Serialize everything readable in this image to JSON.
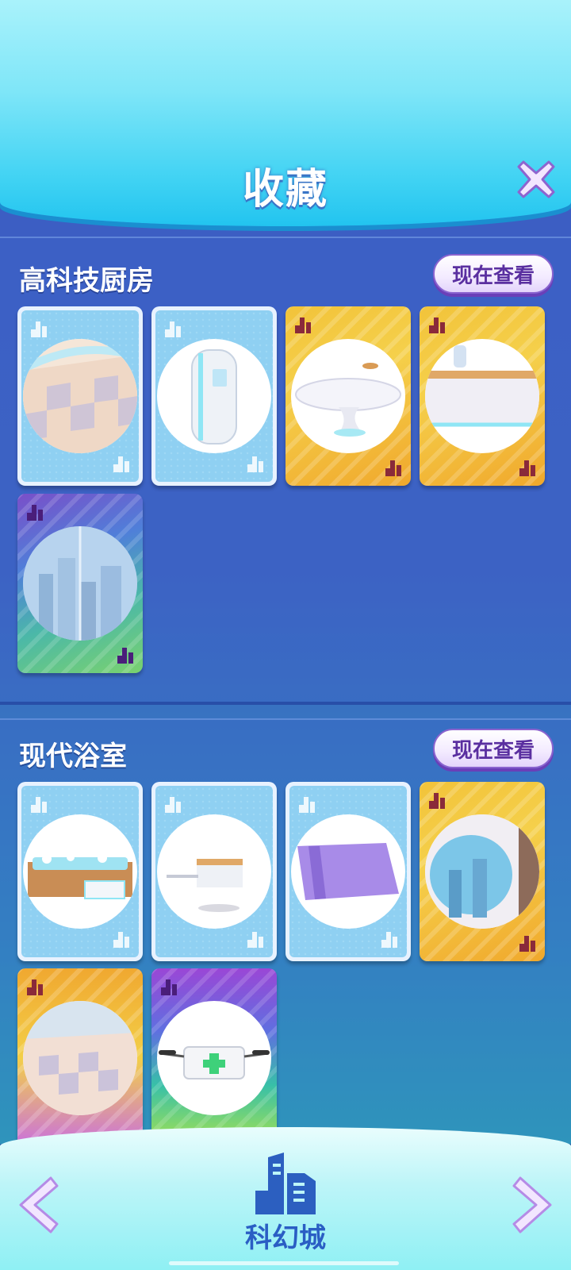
{
  "header": {
    "title": "收藏",
    "close_icon": "close-icon"
  },
  "sections": [
    {
      "title": "高科技厨房",
      "view_label": "现在查看",
      "cards": [
        {
          "frame": "blue",
          "item": "tiled-floor"
        },
        {
          "frame": "blue",
          "item": "fridge-pod"
        },
        {
          "frame": "gold",
          "item": "round-table"
        },
        {
          "frame": "gold",
          "item": "kitchen-counter"
        },
        {
          "frame": "rainbow",
          "item": "city-window"
        }
      ]
    },
    {
      "title": "现代浴室",
      "view_label": "现在查看",
      "cards": [
        {
          "frame": "blue",
          "item": "bathtub"
        },
        {
          "frame": "blue",
          "item": "wall-shelf"
        },
        {
          "frame": "blue",
          "item": "purple-rug"
        },
        {
          "frame": "gold",
          "item": "round-window"
        },
        {
          "frame": "goldpurple",
          "item": "bathroom-floor"
        },
        {
          "frame": "rainbow2",
          "item": "medical-drone"
        }
      ]
    }
  ],
  "footer": {
    "collection_name": "科幻城",
    "prev_icon": "chevron-left-icon",
    "next_icon": "chevron-right-icon",
    "collection_icon": "city-building-icon"
  },
  "colors": {
    "header_top": "#a9f2fb",
    "header_bottom": "#22c4ef",
    "button_text": "#5a2fa0",
    "footer_label": "#2a5ec4"
  }
}
